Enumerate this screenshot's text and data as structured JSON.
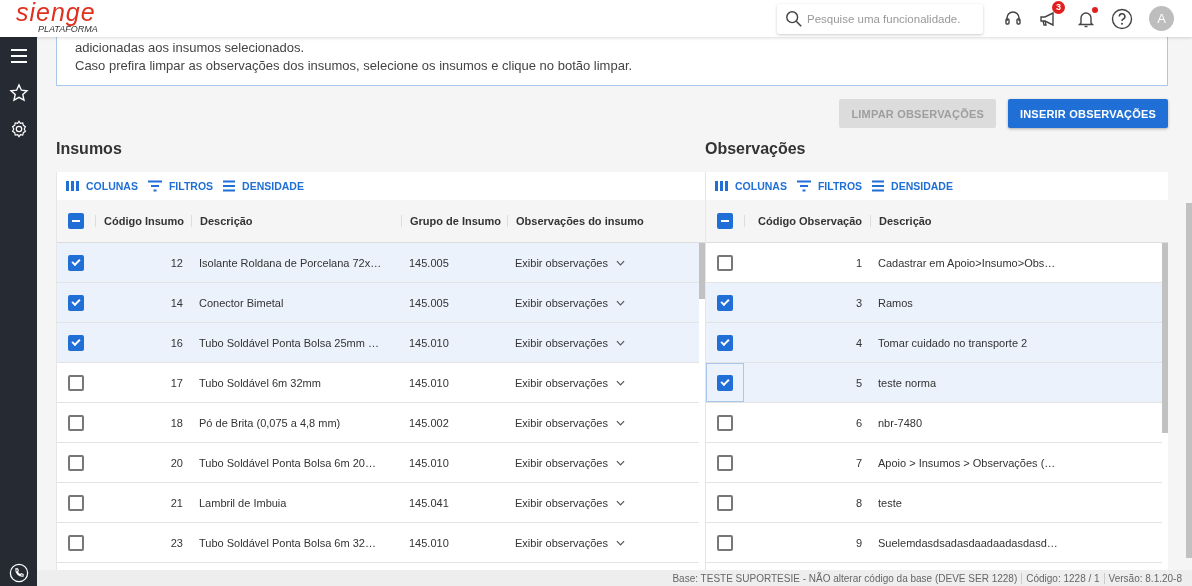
{
  "header": {
    "logo": "sienge",
    "logo_sub": "PLATAFORMA",
    "search": {
      "placeholder": "Pesquise uma funcionalidade."
    },
    "announcements_badge": "3",
    "notification_dot": true,
    "avatar": "A"
  },
  "info": {
    "lines": [
      "adicionadas aos insumos selecionados.",
      "Caso prefira limpar as observações dos insumos, selecione os insumos e clique no botão limpar."
    ]
  },
  "actions": [
    {
      "label": "LIMPAR OBSERVAÇÕES",
      "disabled": true
    },
    {
      "label": "INSERIR OBSERVAÇÕES",
      "disabled": false
    }
  ],
  "insumos": {
    "title": "Insumos",
    "toolbar": [
      "COLUNAS",
      "FILTROS",
      "DENSIDADE"
    ],
    "select_all_indeterminate": true,
    "columns": [
      "Código Insumo",
      "Descrição",
      "Grupo de Insumo",
      "Observações do insumo"
    ],
    "rows": [
      {
        "code": "12",
        "description": "Isolante Roldana de Porcelana 72x…",
        "group": "145.005",
        "observations": "Exibir observações",
        "selected": true
      },
      {
        "code": "14",
        "description": "Conector Bimetal",
        "group": "145.005",
        "observations": "Exibir observações",
        "selected": true
      },
      {
        "code": "16",
        "description": "Tubo Soldável Ponta Bolsa 25mm …",
        "group": "145.010",
        "observations": "Exibir observações",
        "selected": true
      },
      {
        "code": "17",
        "description": "Tubo Soldável 6m 32mm",
        "group": "145.010",
        "observations": "Exibir observações",
        "selected": false
      },
      {
        "code": "18",
        "description": "Pó de Brita (0,075 a 4,8 mm)",
        "group": "145.002",
        "observations": "Exibir observações",
        "selected": false
      },
      {
        "code": "20",
        "description": "Tubo Soldável Ponta Bolsa 6m 20…",
        "group": "145.010",
        "observations": "Exibir observações",
        "selected": false
      },
      {
        "code": "21",
        "description": "Lambril de Imbuia",
        "group": "145.041",
        "observations": "Exibir observações",
        "selected": false
      },
      {
        "code": "23",
        "description": "Tubo Soldável Ponta Bolsa 6m 32…",
        "group": "145.010",
        "observations": "Exibir observações",
        "selected": false
      }
    ]
  },
  "observacoes": {
    "title": "Observações",
    "toolbar": [
      "COLUNAS",
      "FILTROS",
      "DENSIDADE"
    ],
    "select_all_indeterminate": true,
    "columns": [
      "Código Observação",
      "Descrição"
    ],
    "rows": [
      {
        "code": "1",
        "description": "Cadastrar em Apoio>Insumo>Obs…",
        "selected": false,
        "focused": false
      },
      {
        "code": "3",
        "description": "Ramos",
        "selected": true,
        "focused": false
      },
      {
        "code": "4",
        "description": "Tomar cuidado no transporte 2",
        "selected": true,
        "focused": false
      },
      {
        "code": "5",
        "description": "teste norma",
        "selected": true,
        "focused": true
      },
      {
        "code": "6",
        "description": "nbr-7480",
        "selected": false,
        "focused": false
      },
      {
        "code": "7",
        "description": "Apoio > Insumos > Observações (…",
        "selected": false,
        "focused": false
      },
      {
        "code": "8",
        "description": "teste",
        "selected": false,
        "focused": false
      },
      {
        "code": "9",
        "description": "Suelemdasdsadasdaadaadasdasd…",
        "selected": false,
        "focused": false
      }
    ]
  },
  "status_bar": [
    "Base: TESTE SUPORTESIE - NÃO alterar código da base (DEVE SER 1228)",
    "Código: 1228 / 1",
    "Versão: 8.1.20-8"
  ]
}
